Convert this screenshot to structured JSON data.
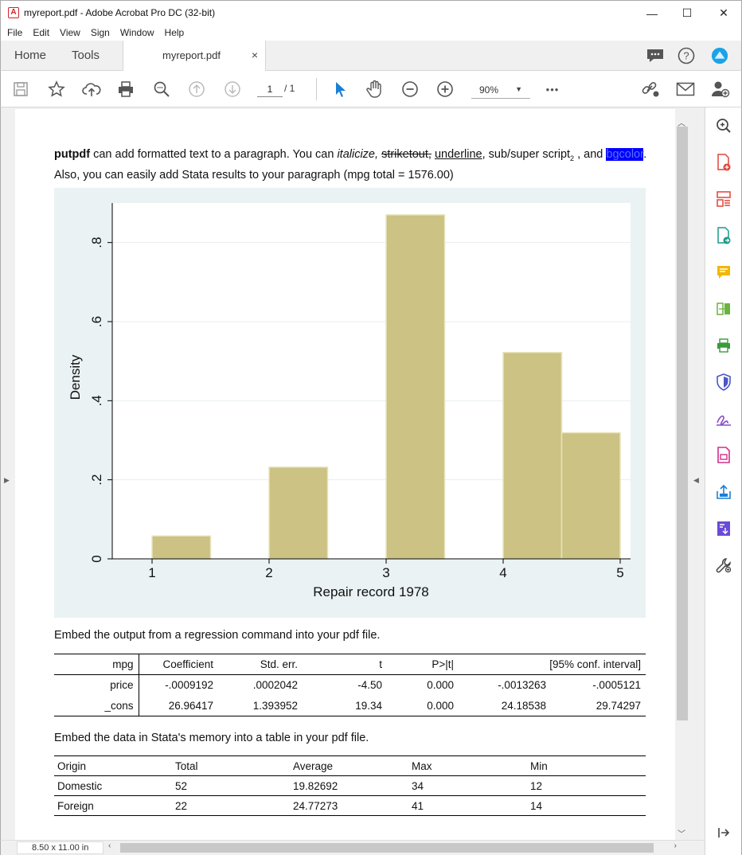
{
  "window": {
    "title": "myreport.pdf - Adobe Acrobat Pro DC (32-bit)",
    "minimize": "—",
    "maximize": "☐",
    "close": "✕"
  },
  "menu": [
    "File",
    "Edit",
    "View",
    "Sign",
    "Window",
    "Help"
  ],
  "tabs": {
    "home": "Home",
    "tools": "Tools",
    "document": "myreport.pdf",
    "close": "×"
  },
  "toolbar": {
    "page_current": "1",
    "page_total": "/ 1",
    "zoom": "90%",
    "more": "•••"
  },
  "paragraph": {
    "bold": "putpdf",
    "t1": " can add formatted text to a paragraph.  You can ",
    "italic": "italicize,",
    "t2": " ",
    "strike": "striketout,",
    "t3": " ",
    "underline": "underline",
    "t4": ", sub/super script",
    "sub": "2",
    "t5": " , and ",
    "bgcolor": "bgcolor",
    "t6": ".  Also, you can easily add Stata results to your paragraph (mpg total = 1576.00)"
  },
  "chart_data": {
    "type": "bar",
    "xlabel": "Repair record 1978",
    "ylabel": "Density",
    "x_ticks": [
      "1",
      "2",
      "3",
      "4",
      "5"
    ],
    "y_ticks": [
      "0",
      ".2",
      ".4",
      ".6",
      ".8"
    ],
    "xlim": [
      1,
      5
    ],
    "ylim": [
      0,
      0.9
    ],
    "bins": [
      {
        "x0": 1.0,
        "x1": 1.5,
        "density": 0.058
      },
      {
        "x0": 2.0,
        "x1": 2.5,
        "density": 0.232
      },
      {
        "x0": 3.0,
        "x1": 3.5,
        "density": 0.87
      },
      {
        "x0": 4.0,
        "x1": 4.5,
        "density": 0.522
      },
      {
        "x0": 4.5,
        "x1": 5.0,
        "density": 0.319
      }
    ],
    "bar_color": "#cbc283",
    "grid": true
  },
  "regression": {
    "caption": "Embed the output from a regression command into your pdf file.",
    "headers": [
      "mpg",
      "Coefficient",
      "Std. err.",
      "t",
      "P>|t|",
      "[95% conf. interval]"
    ],
    "rows": [
      [
        "price",
        "-.0009192",
        ".0002042",
        "-4.50",
        "0.000",
        "-.0013263",
        "-.0005121"
      ],
      [
        "_cons",
        "26.96417",
        "1.393952",
        "19.34",
        "0.000",
        "24.18538",
        "29.74297"
      ]
    ]
  },
  "datatable": {
    "caption": "Embed the data in Stata's memory into a table in your pdf file.",
    "headers": [
      "Origin",
      "Total",
      "Average",
      "Max",
      "Min"
    ],
    "rows": [
      [
        "Domestic",
        "52",
        "19.82692",
        "34",
        "12"
      ],
      [
        "Foreign",
        "22",
        "24.77273",
        "41",
        "14"
      ]
    ]
  },
  "status": {
    "page_size": "8.50 x 11.00 in"
  },
  "colors": {
    "accent_blue": "#1a7fd6",
    "acrobat_red": "#d2232a"
  }
}
